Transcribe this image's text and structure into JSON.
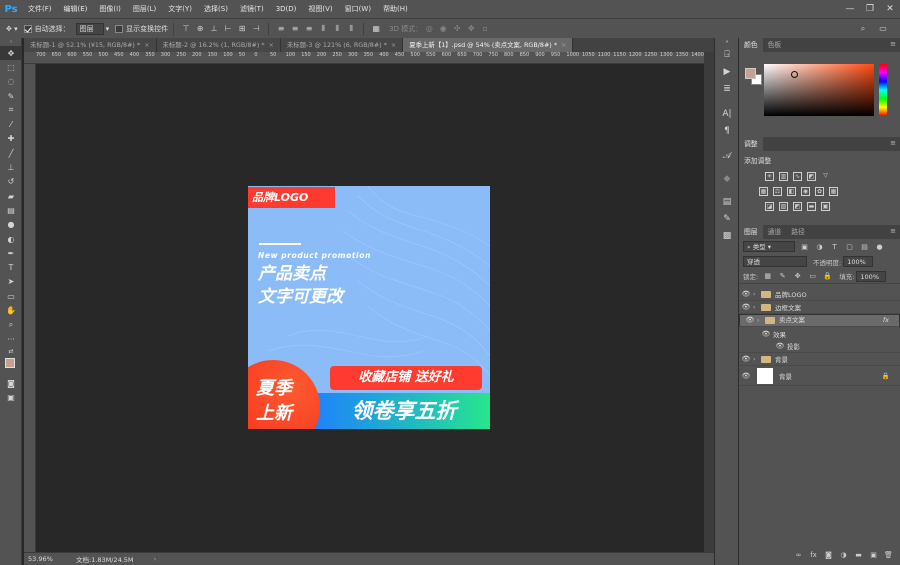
{
  "app": {
    "logo": "Ps"
  },
  "menu": [
    "文件(F)",
    "编辑(E)",
    "图像(I)",
    "图层(L)",
    "文字(Y)",
    "选择(S)",
    "滤镜(T)",
    "3D(D)",
    "视图(V)",
    "窗口(W)",
    "帮助(H)"
  ],
  "options": {
    "auto_select_label": "自动选择：",
    "auto_select_value": "图层",
    "show_transform_label": "显示变换控件",
    "mode_3d": "3D 模式："
  },
  "tabs": [
    {
      "label": "未标题-1 @ 52.1% (¥15, RGB/8#) *",
      "active": false
    },
    {
      "label": "未标题-2 @ 16.2% (1, RGB/8#) *",
      "active": false
    },
    {
      "label": "未标题-3 @ 121% (6, RGB/8#) *",
      "active": false
    },
    {
      "label": "夏季上新【1】.psd @ 54% (卖点文案, RGB/8#) *",
      "active": true
    }
  ],
  "ruler_ticks": [
    "700",
    "650",
    "600",
    "550",
    "500",
    "450",
    "400",
    "350",
    "300",
    "250",
    "200",
    "150",
    "100",
    "50",
    "0",
    "50",
    "100",
    "150",
    "200",
    "250",
    "300",
    "350",
    "400",
    "450",
    "500",
    "550",
    "600",
    "650",
    "700",
    "750",
    "800",
    "850",
    "900",
    "950",
    "1000",
    "1050",
    "1100",
    "1150",
    "1200",
    "1250",
    "1300",
    "1350",
    "1400"
  ],
  "artwork": {
    "logo_text": "品牌LOGO",
    "en_text": "New product promotion",
    "headline1": "产品卖点",
    "headline2": "文字可更改",
    "circle_line1": "夏季",
    "circle_line2": "上新",
    "red_pill": "收藏店铺  送好礼",
    "green_bar": "领卷享五折",
    "colors": {
      "bg": "#8bbcf7",
      "red": "#ff3a2e",
      "green": "#28e68a",
      "blue": "#1f7fff"
    }
  },
  "status": {
    "zoom": "53.96%",
    "doc": "文档:1.83M/24.5M"
  },
  "panels": {
    "color_tabs": [
      "颜色",
      "色板"
    ],
    "adjust_tab": "调整",
    "adjust_add": "添加调整",
    "layer_tabs": [
      "图层",
      "通道",
      "路径"
    ],
    "filter_kind": "类型",
    "blend_mode": "穿透",
    "opacity_label": "不透明度:",
    "opacity_value": "100%",
    "lock_label": "锁定:",
    "fill_label": "填充:",
    "fill_value": "100%",
    "layers": [
      {
        "name": "品牌LOGO",
        "type": "group",
        "selected": false
      },
      {
        "name": "边框文案",
        "type": "group",
        "selected": false
      },
      {
        "name": "卖点文案",
        "type": "group",
        "selected": true,
        "fx": "fx"
      },
      {
        "name": "效果",
        "type": "effects",
        "selected": false
      },
      {
        "name": "投影",
        "type": "effect",
        "selected": false
      },
      {
        "name": "背景",
        "type": "group",
        "selected": false
      },
      {
        "name": "背景",
        "type": "background",
        "selected": false
      }
    ]
  }
}
